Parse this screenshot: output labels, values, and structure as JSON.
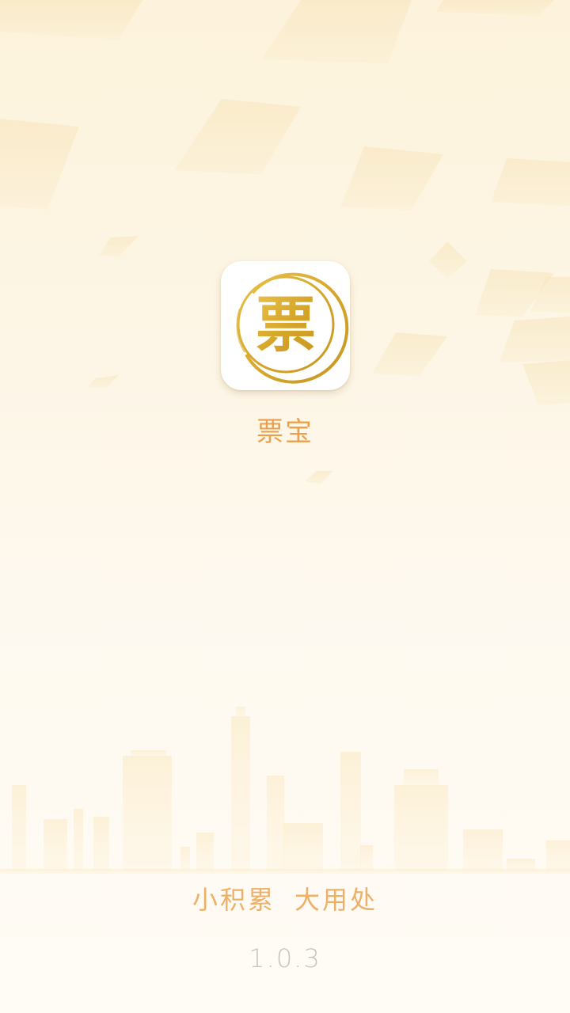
{
  "splash": {
    "app_name": "票宝",
    "logo_char": "票",
    "slogan_left": "小积累",
    "slogan_right": "大用处",
    "version": "1.0.3"
  },
  "colors": {
    "accent": "#eaa04c",
    "logo_gold": "#d8ac2e",
    "version_gray": "#c9c4bb"
  },
  "icons": {
    "app_logo": "piao-seal-icon"
  }
}
